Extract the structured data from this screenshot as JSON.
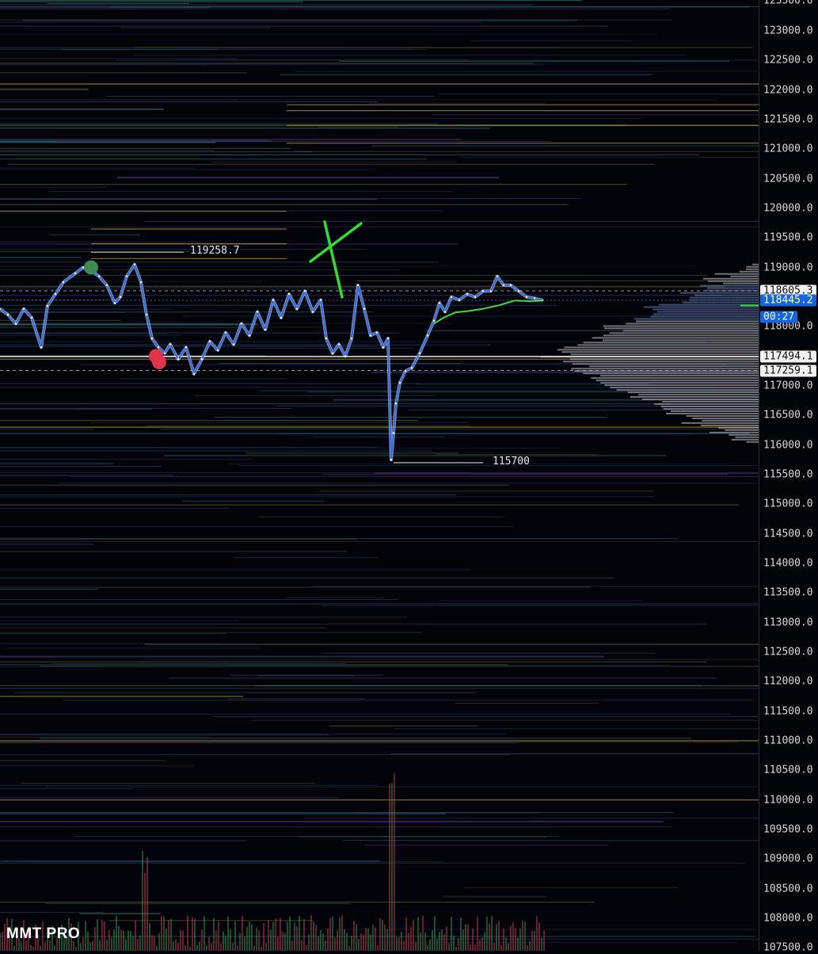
{
  "brand": "MMT PRO",
  "chart_data": {
    "type": "line",
    "y_axis": {
      "ticks": [
        "123500.0",
        "123000.0",
        "122500.0",
        "122000.0",
        "121500.0",
        "121000.0",
        "120500.0",
        "120000.0",
        "119500.0",
        "119000.0",
        "118000.0",
        "117000.0",
        "116500.0",
        "116000.0",
        "115500.0",
        "115000.0",
        "114500.0",
        "114000.0",
        "113500.0",
        "113000.0",
        "112500.0",
        "112000.0",
        "111500.0",
        "111000.0",
        "110500.0",
        "110000.0",
        "109500.0",
        "109000.0",
        "108500.0",
        "108000.0",
        "107500.0"
      ],
      "ylim": [
        107450,
        123520
      ]
    },
    "price_tags": [
      {
        "text": "118605.3",
        "price": 118605.3,
        "style": "white"
      },
      {
        "text": "118445.2",
        "price": 118445.2,
        "style": "blue"
      },
      {
        "text": "00:27",
        "price": 118170,
        "style": "blue"
      },
      {
        "text": "117494.1",
        "price": 117494.1,
        "style": "white"
      },
      {
        "text": "117259.1",
        "price": 117259.1,
        "style": "white"
      }
    ],
    "annotations": [
      {
        "text": "119258.7",
        "price": 119258.7
      },
      {
        "text": "115700",
        "price": 115700
      }
    ],
    "series": [
      {
        "color": "#2f6df0",
        "x": [
          0,
          10,
          20,
          30,
          40,
          52,
          60,
          70,
          80,
          95,
          105,
          115,
          125,
          135,
          145,
          152,
          160,
          170,
          178,
          185,
          192,
          200,
          208,
          215,
          225,
          235,
          245,
          255,
          265,
          275,
          285,
          295,
          305,
          315,
          325,
          335,
          345,
          355,
          365,
          375,
          385,
          395,
          405,
          412,
          420,
          428,
          436,
          444,
          452,
          460,
          468,
          476,
          484,
          490,
          494,
          497,
          500,
          505,
          512,
          520,
          530,
          540,
          548,
          555,
          562,
          570,
          580,
          590,
          600,
          610,
          620,
          628,
          636,
          645,
          655,
          665,
          675,
          685
        ],
        "y": [
          118300,
          118200,
          118050,
          118300,
          118150,
          117650,
          118350,
          118550,
          118750,
          118900,
          119000,
          118950,
          118850,
          118700,
          118400,
          118500,
          118850,
          119050,
          118750,
          118200,
          117800,
          117650,
          117550,
          117700,
          117450,
          117650,
          117200,
          117450,
          117750,
          117600,
          117900,
          117700,
          118050,
          117850,
          118250,
          117950,
          118450,
          118150,
          118550,
          118300,
          118600,
          118250,
          118450,
          117800,
          117550,
          117700,
          117500,
          117800,
          118700,
          118300,
          117850,
          117900,
          117650,
          117800,
          115750,
          116200,
          116700,
          117050,
          117250,
          117300,
          117550,
          117850,
          118100,
          118400,
          118250,
          118500,
          118450,
          118550,
          118500,
          118600,
          118600,
          118850,
          118700,
          118700,
          118600,
          118500,
          118480,
          118445
        ]
      },
      {
        "color": "#3ddc3d",
        "x": [
          548,
          560,
          575,
          590,
          610,
          630,
          650,
          670,
          685
        ],
        "y": [
          118050,
          118150,
          118240,
          118260,
          118300,
          118360,
          118440,
          118430,
          118440
        ]
      }
    ],
    "markers": [
      {
        "x": 115,
        "price": 119000,
        "color": "#3f8a52"
      },
      {
        "x": 197,
        "price": 117500,
        "color": "#e0334a"
      },
      {
        "x": 201,
        "price": 117400,
        "color": "#e0334a"
      }
    ]
  }
}
